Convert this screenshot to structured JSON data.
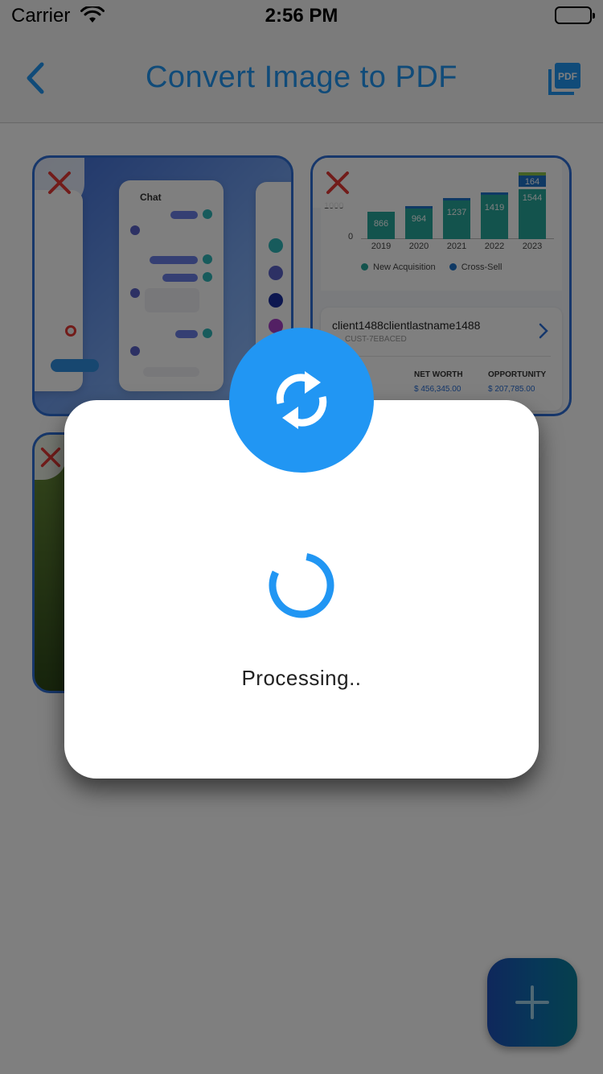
{
  "status_bar": {
    "carrier": "Carrier",
    "time": "2:56 PM"
  },
  "nav": {
    "title": "Convert Image to PDF",
    "pdf_icon_text": "PDF",
    "accent_color": "#2196f3"
  },
  "thumbnails": {
    "card1": {
      "chat_title": "Chat"
    },
    "card2": {
      "y_ticks": [
        "1000",
        "0"
      ],
      "years": [
        "2019",
        "2020",
        "2021",
        "2022",
        "2023"
      ],
      "bar_values": [
        "866",
        "964",
        "1237",
        "1419",
        "1544"
      ],
      "top_value": "164",
      "legend": [
        "New Acquisition",
        "Cross-Sell"
      ],
      "client_name": "client1488clientlastname1488",
      "client_id": "CUST-7EBACED",
      "stats": [
        {
          "label": "NET WORTH",
          "value": "$ 456,345.00"
        },
        {
          "label": "OPPORTUNITY",
          "value": "$ 207,785.00"
        }
      ]
    }
  },
  "dialog": {
    "message": "Processing.."
  },
  "icons": {
    "back": "chevron-left-icon",
    "pdf": "pdf-icon",
    "remove": "close-icon",
    "sync": "sync-icon",
    "add": "plus-icon"
  }
}
